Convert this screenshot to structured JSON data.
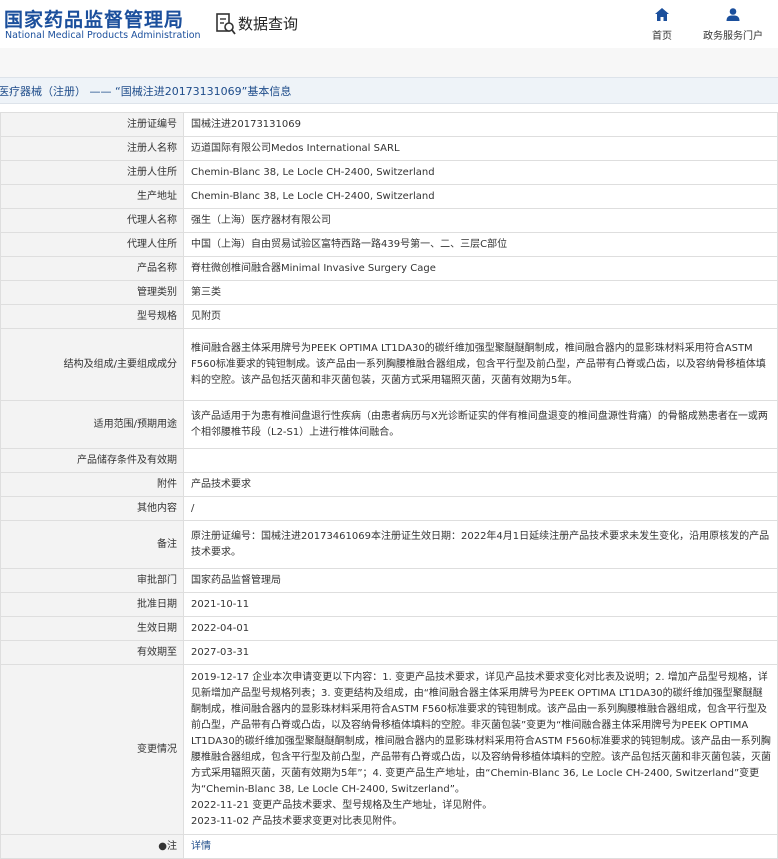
{
  "header": {
    "logo_cn": "国家药品监督管理局",
    "logo_en": "National Medical Products Administration",
    "section_title": "数据查询",
    "nav": [
      {
        "label": "首页",
        "icon": "home-icon"
      },
      {
        "label": "政务服务门户",
        "icon": "user-icon"
      }
    ]
  },
  "breadcrumb": "医疗器械（注册） —— “国械注进20173131069”基本信息",
  "colors": {
    "brand_blue": "#1b4f9c",
    "label_bg": "#f3f3f3",
    "breadcrumb_bg": "#eef3f8"
  },
  "rows": [
    {
      "label": "注册证编号",
      "value": "国械注进20173131069"
    },
    {
      "label": "注册人名称",
      "value": "迈道国际有限公司Medos International SARL"
    },
    {
      "label": "注册人住所",
      "value": "Chemin-Blanc 38, Le Locle CH-2400, Switzerland"
    },
    {
      "label": "生产地址",
      "value": "Chemin-Blanc 38, Le Locle CH-2400, Switzerland"
    },
    {
      "label": "代理人名称",
      "value": "强生（上海）医疗器材有限公司"
    },
    {
      "label": "代理人住所",
      "value": "中国（上海）自由贸易试验区富特西路一路439号第一、二、三层C部位"
    },
    {
      "label": "产品名称",
      "value": "脊柱微创椎间融合器Minimal Invasive Surgery Cage"
    },
    {
      "label": "管理类别",
      "value": "第三类"
    },
    {
      "label": "型号规格",
      "value": "见附页"
    },
    {
      "label": "结构及组成/主要组成成分",
      "value": "椎间融合器主体采用牌号为PEEK OPTIMA LT1DA30的碳纤维加强型聚醚醚酮制成，椎间融合器内的显影珠材料采用符合ASTM F560标准要求的钝钽制成。该产品由一系列胸腰椎融合器组成，包含平行型及前凸型，产品带有凸脊或凸齿，以及容纳骨移植体填料的空腔。该产品包括灭菌和非灭菌包装，灭菌方式采用辐照灭菌，灭菌有效期为5年。"
    },
    {
      "label": "适用范围/预期用途",
      "value": "该产品适用于为患有椎间盘退行性疾病（由患者病历与X光诊断证实的伴有椎间盘退变的椎间盘源性背痛）的骨骼成熟患者在一或两个相邻腰椎节段（L2-S1）上进行椎体间融合。"
    },
    {
      "label": "产品储存条件及有效期",
      "value": ""
    },
    {
      "label": "附件",
      "value": "产品技术要求"
    },
    {
      "label": "其他内容",
      "value": "/"
    },
    {
      "label": "备注",
      "value": "原注册证编号：国械注进20173461069本注册证生效日期：2022年4月1日延续注册产品技术要求未发生变化，沿用原核发的产品技术要求。"
    },
    {
      "label": "审批部门",
      "value": "国家药品监督管理局"
    },
    {
      "label": "批准日期",
      "value": "2021-10-11"
    },
    {
      "label": "生效日期",
      "value": "2022-04-01"
    },
    {
      "label": "有效期至",
      "value": "2027-03-31"
    }
  ],
  "change_row": {
    "label": "变更情况",
    "lines": [
      "2019-12-17 企业本次申请变更以下内容：1. 变更产品技术要求，详见产品技术要求变化对比表及说明；2. 增加产品型号规格，详见新增加产品型号规格列表；3. 变更结构及组成，由“椎间融合器主体采用牌号为PEEK OPTIMA LT1DA30的碳纤维加强型聚醚醚酮制成，椎间融合器内的显影珠材料采用符合ASTM F560标准要求的钝钽制成。该产品由一系列胸腰椎融合器组成，包含平行型及前凸型，产品带有凸脊或凸齿，以及容纳骨移植体填料的空腔。非灭菌包装”变更为“椎间融合器主体采用牌号为PEEK OPTIMA LT1DA30的碳纤维加强型聚醚醚酮制成，椎间融合器内的显影珠材料采用符合ASTM F560标准要求的钝钽制成。该产品由一系列胸腰椎融合器组成，包含平行型及前凸型，产品带有凸脊或凸齿，以及容纳骨移植体填料的空腔。该产品包括灭菌和非灭菌包装，灭菌方式采用辐照灭菌，灭菌有效期为5年”；4. 变更产品生产地址，由“Chemin-Blanc 36, Le Locle CH-2400, Switzerland”变更为“Chemin-Blanc 38, Le Locle CH-2400, Switzerland”。",
      "2022-11-21 变更产品技术要求、型号规格及生产地址，详见附件。",
      "2023-11-02 产品技术要求变更对比表见附件。"
    ]
  },
  "detail_row": {
    "label": "●注",
    "link": "详情"
  }
}
